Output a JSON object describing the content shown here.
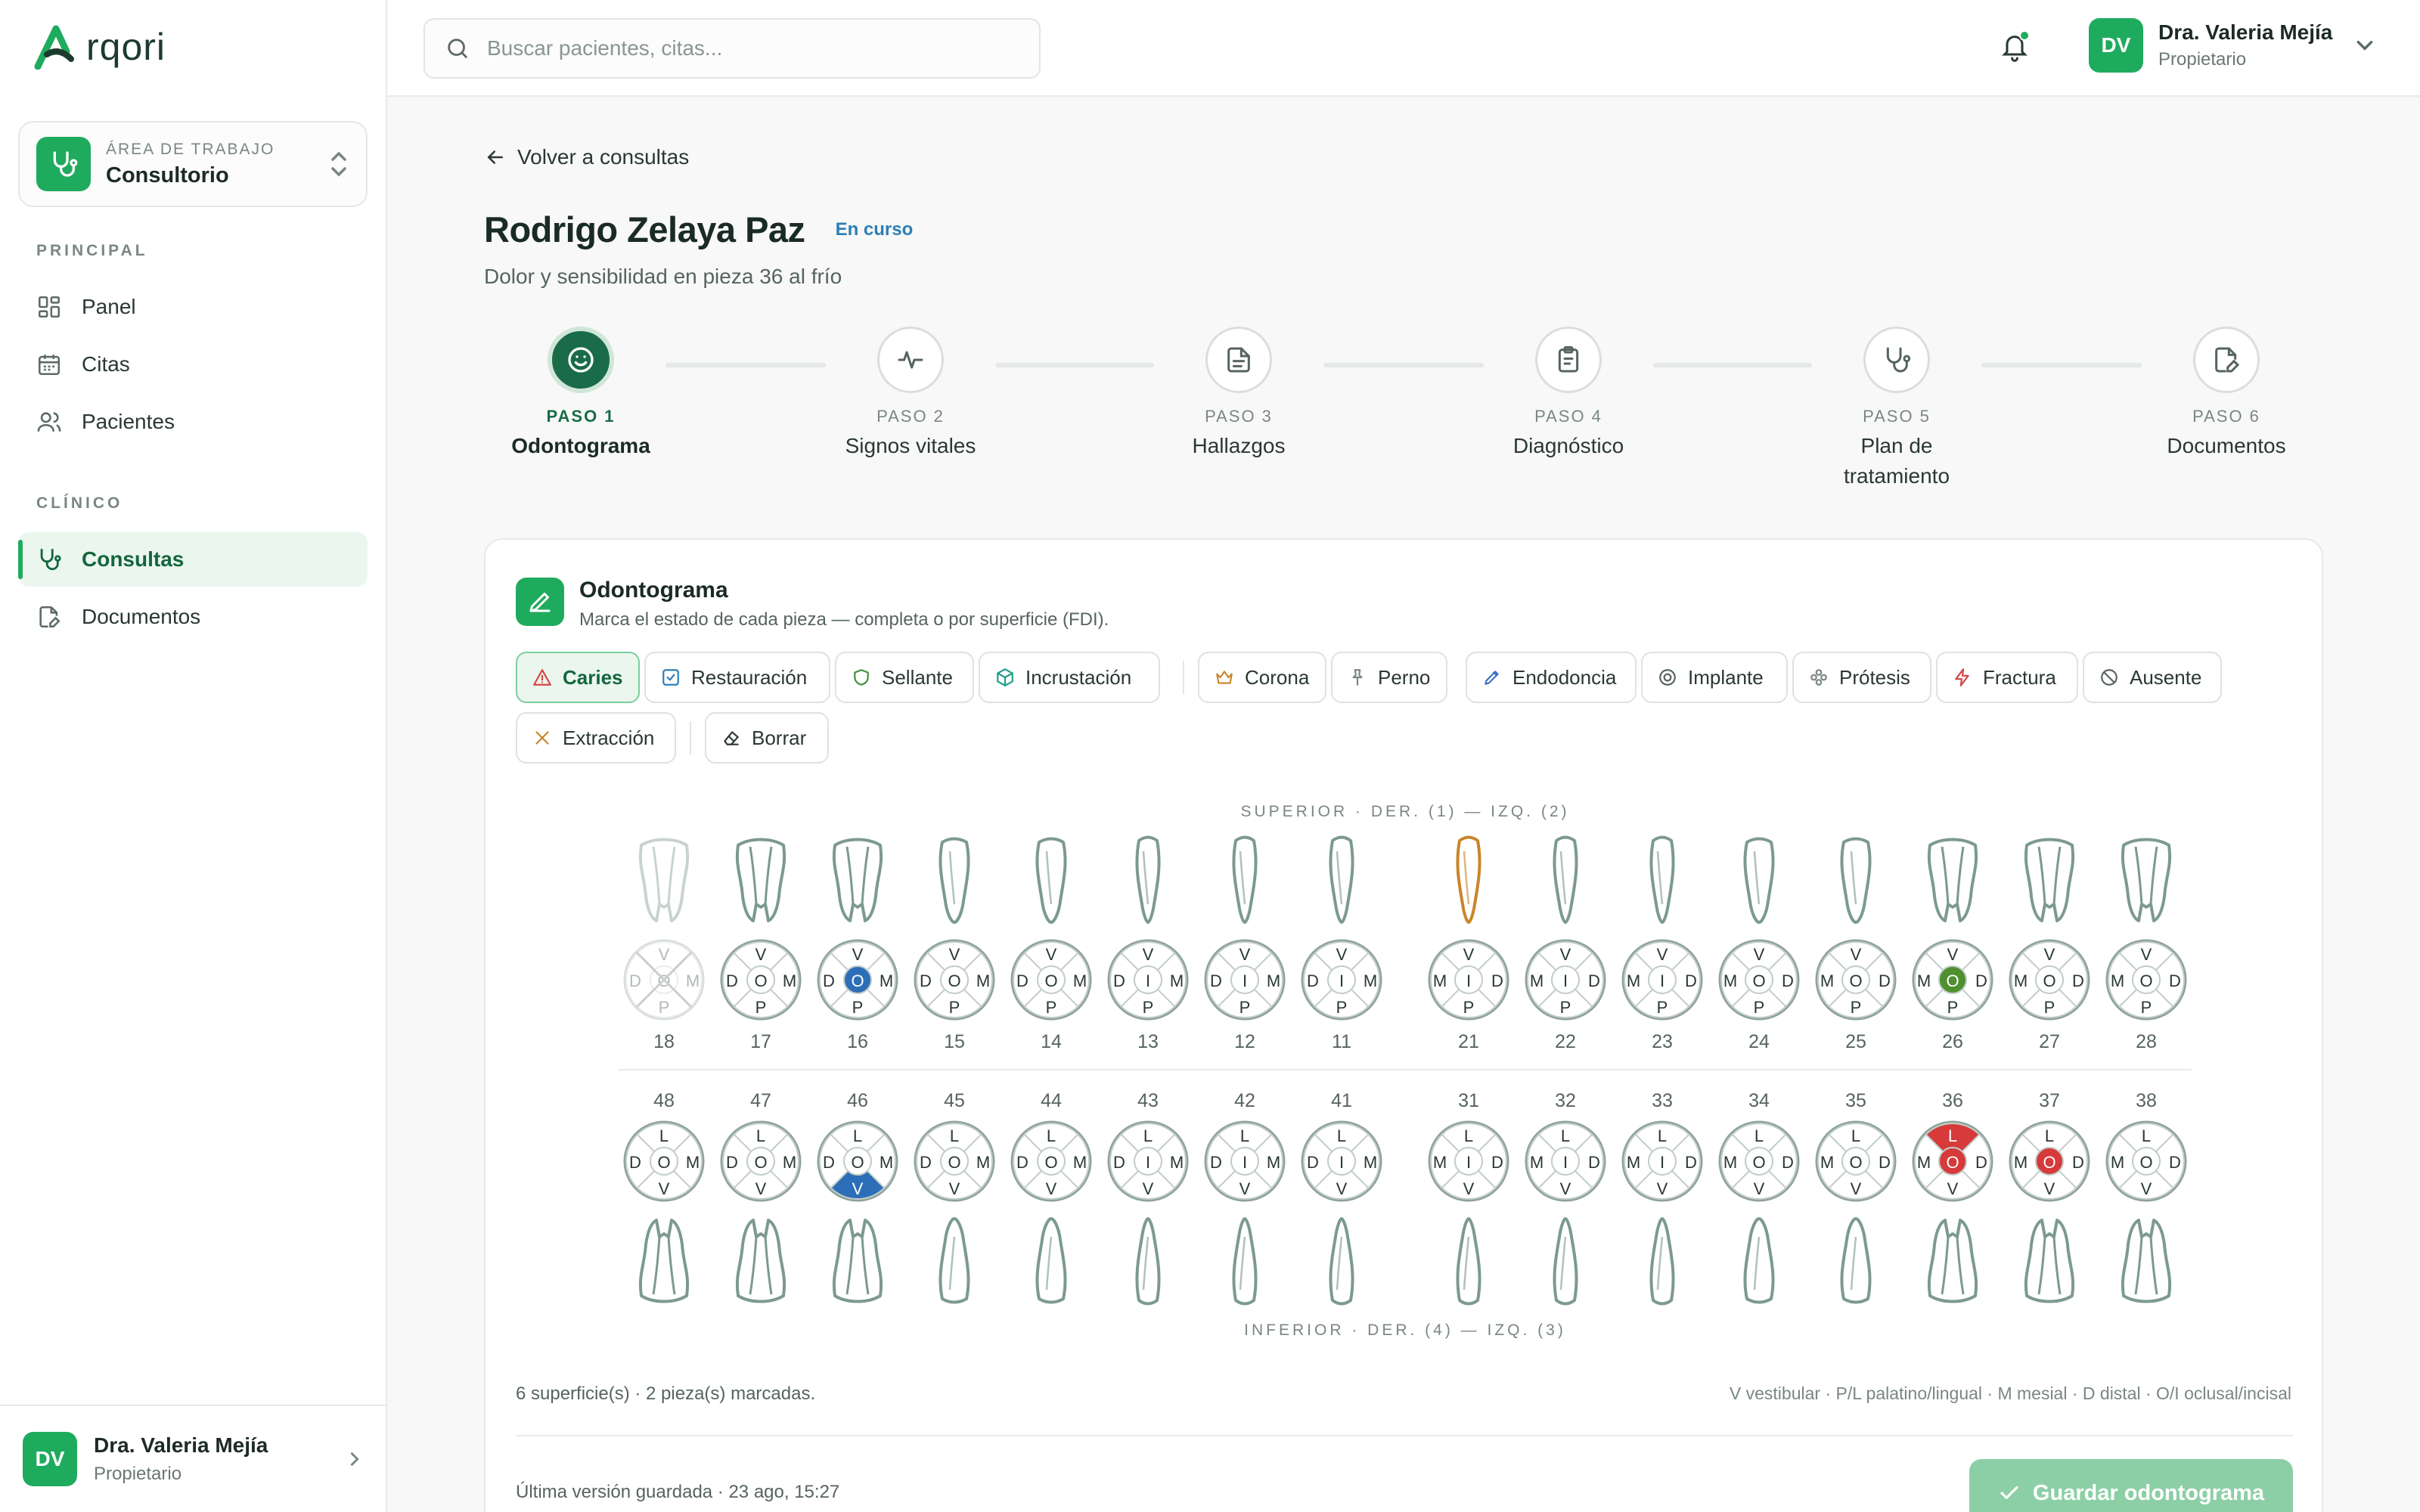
{
  "brand": {
    "name": "rqori"
  },
  "workspace": {
    "label": "ÁREA DE TRABAJO",
    "name": "Consultorio"
  },
  "sidebar": {
    "sections": [
      {
        "title": "PRINCIPAL",
        "items": [
          {
            "label": "Panel",
            "icon": "grid-icon"
          },
          {
            "label": "Citas",
            "icon": "calendar-icon"
          },
          {
            "label": "Pacientes",
            "icon": "users-icon"
          }
        ]
      },
      {
        "title": "CLÍNICO",
        "items": [
          {
            "label": "Consultas",
            "icon": "stethoscope-icon",
            "active": true
          },
          {
            "label": "Documentos",
            "icon": "document-edit-icon"
          }
        ]
      }
    ]
  },
  "user": {
    "initials": "DV",
    "name": "Dra. Valeria Mejía",
    "role": "Propietario"
  },
  "search": {
    "placeholder": "Buscar pacientes, citas..."
  },
  "page": {
    "back_label": "Volver a consultas",
    "patient": "Rodrigo Zelaya Paz",
    "status": "En curso",
    "complaint": "Dolor y sensibilidad en pieza 36 al frío"
  },
  "steps": [
    {
      "kicker": "PASO 1",
      "title": "Odontograma",
      "active": true
    },
    {
      "kicker": "PASO 2",
      "title": "Signos vitales"
    },
    {
      "kicker": "PASO 3",
      "title": "Hallazgos"
    },
    {
      "kicker": "PASO 4",
      "title": "Diagnóstico"
    },
    {
      "kicker": "PASO 5",
      "title": "Plan de tratamiento"
    },
    {
      "kicker": "PASO 6",
      "title": "Documentos"
    }
  ],
  "odontogram": {
    "title": "Odontograma",
    "subtitle": "Marca el estado de cada pieza — completa o por superficie (FDI).",
    "tools": [
      {
        "label": "Caries",
        "icon": "warning-icon",
        "color": "#d64545",
        "active": true
      },
      {
        "label": "Restauración",
        "icon": "check-square-icon",
        "color": "#2c7fb8"
      },
      {
        "label": "Sellante",
        "icon": "shield-icon",
        "color": "#3f8f3f"
      },
      {
        "label": "Incrustación",
        "icon": "cube-icon",
        "color": "#1f9e8a"
      },
      {
        "label": "Corona",
        "icon": "crown-icon",
        "color": "#c9852a"
      },
      {
        "label": "Perno",
        "icon": "pin-icon",
        "color": "#7a8782"
      },
      {
        "label": "Endodoncia",
        "icon": "pen-icon",
        "color": "#3b6fc4"
      },
      {
        "label": "Implante",
        "icon": "target-icon",
        "color": "#56645e"
      },
      {
        "label": "Prótesis",
        "icon": "cluster-icon",
        "color": "#7a8782"
      },
      {
        "label": "Fractura",
        "icon": "bolt-icon",
        "color": "#d64545"
      },
      {
        "label": "Ausente",
        "icon": "ban-icon",
        "color": "#56645e"
      },
      {
        "label": "Extracción",
        "icon": "x-icon",
        "color": "#c9852a"
      },
      {
        "label": "Borrar",
        "icon": "eraser-icon",
        "color": "#2a3833"
      }
    ],
    "upper_label": "SUPERIOR · DER. (1) — IZQ. (2)",
    "lower_label": "INFERIOR · DER. (4) — IZQ. (3)",
    "upper": [
      {
        "num": "18",
        "s": [
          "V",
          "D",
          "O",
          "M",
          "P"
        ],
        "missing": true
      },
      {
        "num": "17",
        "s": [
          "V",
          "D",
          "O",
          "M",
          "P"
        ]
      },
      {
        "num": "16",
        "s": [
          "V",
          "D",
          "O",
          "M",
          "P"
        ],
        "fill": {
          "O": "#2c6fb8"
        }
      },
      {
        "num": "15",
        "s": [
          "V",
          "D",
          "O",
          "M",
          "P"
        ]
      },
      {
        "num": "14",
        "s": [
          "V",
          "D",
          "O",
          "M",
          "P"
        ]
      },
      {
        "num": "13",
        "s": [
          "V",
          "D",
          "I",
          "M",
          "P"
        ]
      },
      {
        "num": "12",
        "s": [
          "V",
          "D",
          "I",
          "M",
          "P"
        ]
      },
      {
        "num": "11",
        "s": [
          "V",
          "D",
          "I",
          "M",
          "P"
        ]
      },
      {
        "num": "21",
        "s": [
          "V",
          "M",
          "I",
          "D",
          "P"
        ],
        "crown": true
      },
      {
        "num": "22",
        "s": [
          "V",
          "M",
          "I",
          "D",
          "P"
        ]
      },
      {
        "num": "23",
        "s": [
          "V",
          "M",
          "I",
          "D",
          "P"
        ]
      },
      {
        "num": "24",
        "s": [
          "V",
          "M",
          "O",
          "D",
          "P"
        ]
      },
      {
        "num": "25",
        "s": [
          "V",
          "M",
          "O",
          "D",
          "P"
        ]
      },
      {
        "num": "26",
        "s": [
          "V",
          "M",
          "O",
          "D",
          "P"
        ],
        "fill": {
          "O": "#4f8f2f"
        }
      },
      {
        "num": "27",
        "s": [
          "V",
          "M",
          "O",
          "D",
          "P"
        ]
      },
      {
        "num": "28",
        "s": [
          "V",
          "M",
          "O",
          "D",
          "P"
        ]
      }
    ],
    "lower": [
      {
        "num": "48",
        "s": [
          "L",
          "D",
          "O",
          "M",
          "V"
        ]
      },
      {
        "num": "47",
        "s": [
          "L",
          "D",
          "O",
          "M",
          "V"
        ]
      },
      {
        "num": "46",
        "s": [
          "L",
          "D",
          "O",
          "M",
          "V"
        ],
        "fill": {
          "V": "#2c6fb8"
        }
      },
      {
        "num": "45",
        "s": [
          "L",
          "D",
          "O",
          "M",
          "V"
        ]
      },
      {
        "num": "44",
        "s": [
          "L",
          "D",
          "O",
          "M",
          "V"
        ]
      },
      {
        "num": "43",
        "s": [
          "L",
          "D",
          "I",
          "M",
          "V"
        ]
      },
      {
        "num": "42",
        "s": [
          "L",
          "D",
          "I",
          "M",
          "V"
        ]
      },
      {
        "num": "41",
        "s": [
          "L",
          "D",
          "I",
          "M",
          "V"
        ]
      },
      {
        "num": "31",
        "s": [
          "L",
          "M",
          "I",
          "D",
          "V"
        ]
      },
      {
        "num": "32",
        "s": [
          "L",
          "M",
          "I",
          "D",
          "V"
        ]
      },
      {
        "num": "33",
        "s": [
          "L",
          "M",
          "I",
          "D",
          "V"
        ]
      },
      {
        "num": "34",
        "s": [
          "L",
          "M",
          "O",
          "D",
          "V"
        ]
      },
      {
        "num": "35",
        "s": [
          "L",
          "M",
          "O",
          "D",
          "V"
        ]
      },
      {
        "num": "36",
        "s": [
          "L",
          "M",
          "O",
          "D",
          "V"
        ],
        "fill": {
          "L": "#d63a3a",
          "O": "#d63a3a"
        }
      },
      {
        "num": "37",
        "s": [
          "L",
          "M",
          "O",
          "D",
          "V"
        ],
        "fill": {
          "O": "#d63a3a"
        }
      },
      {
        "num": "38",
        "s": [
          "L",
          "M",
          "O",
          "D",
          "V"
        ]
      }
    ],
    "summary": "6 superficie(s) · 2 pieza(s) marcadas.",
    "legend": "V vestibular · P/L palatino/lingual · M mesial · D distal · O/I oclusal/incisal",
    "saved": "Última versión guardada · 23 ago, 15:27",
    "save_label": "Guardar odontograma"
  },
  "colors": {
    "accent": "#1fab5e",
    "accent_dark": "#1a6b48",
    "tooth": "#7c9a8e",
    "caries": "#d63a3a",
    "restoration": "#2c6fb8",
    "sealant": "#4f8f2f",
    "crown": "#c9852a"
  }
}
